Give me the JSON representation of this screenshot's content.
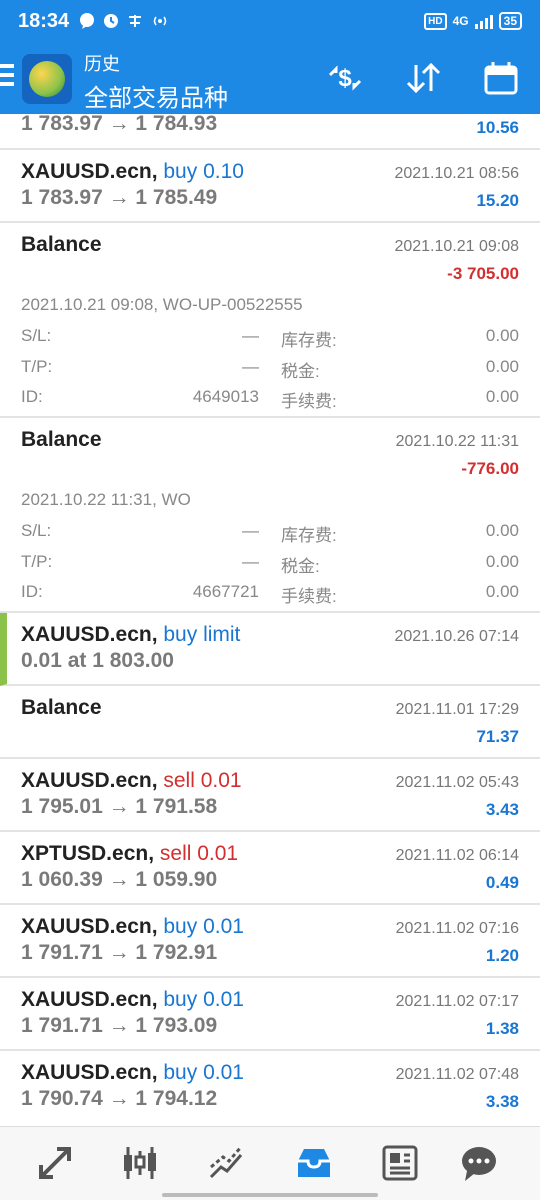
{
  "status_bar": {
    "time": "18:34",
    "net": "4G",
    "battery": "35",
    "hd": "HD"
  },
  "header": {
    "title": "历史",
    "subtitle": "全部交易品种"
  },
  "top_partial": {
    "prices": "1 783.97 → 1 784.93",
    "profit": "10.56"
  },
  "rows": [
    {
      "symbol": "XAUUSD.ecn,",
      "direction": "buy 0.10",
      "dir_color": "blue",
      "prices": "1 783.97 → 1 785.49",
      "date": "2021.10.21 08:56",
      "profit": "15.20"
    },
    {
      "symbol": "XAUUSD.ecn,",
      "direction": "buy limit",
      "dir_color": "blue",
      "prices": "0.01 at 1 803.00",
      "date": "2021.10.26 07:14",
      "profit": ""
    },
    {
      "symbol": "XAUUSD.ecn,",
      "direction": "sell 0.01",
      "dir_color": "red",
      "prices": "1 795.01 → 1 791.58",
      "date": "2021.11.02 05:43",
      "profit": "3.43"
    },
    {
      "symbol": "XPTUSD.ecn,",
      "direction": "sell 0.01",
      "dir_color": "red",
      "prices": "1 060.39 → 1 059.90",
      "date": "2021.11.02 06:14",
      "profit": "0.49"
    },
    {
      "symbol": "XAUUSD.ecn,",
      "direction": "buy 0.01",
      "dir_color": "blue",
      "prices": "1 791.71 → 1 792.91",
      "date": "2021.11.02 07:16",
      "profit": "1.20"
    },
    {
      "symbol": "XAUUSD.ecn,",
      "direction": "buy 0.01",
      "dir_color": "blue",
      "prices": "1 791.71 → 1 793.09",
      "date": "2021.11.02 07:17",
      "profit": "1.38"
    },
    {
      "symbol": "XAUUSD.ecn,",
      "direction": "buy 0.01",
      "dir_color": "blue",
      "prices": "1 790.74 → 1 794.12",
      "date": "2021.11.02 07:48",
      "profit": "3.38"
    }
  ],
  "balances": [
    {
      "title": "Balance",
      "date": "2021.10.21 09:08",
      "amount": "-3 705.00",
      "comment": "2021.10.21 09:08, WO-UP-00522555",
      "sl_label": "S/L:",
      "sl_value": "—",
      "tp_label": "T/P:",
      "tp_value": "—",
      "id_label": "ID:",
      "id_value": "4649013",
      "swap_label": "库存费:",
      "swap_value": "0.00",
      "tax_label": "税金:",
      "tax_value": "0.00",
      "fee_label": "手续费:",
      "fee_value": "0.00"
    },
    {
      "title": "Balance",
      "date": "2021.10.22 11:31",
      "amount": "-776.00",
      "comment": "2021.10.22 11:31, WO",
      "sl_label": "S/L:",
      "sl_value": "—",
      "tp_label": "T/P:",
      "tp_value": "—",
      "id_label": "ID:",
      "id_value": "4667721",
      "swap_label": "库存费:",
      "swap_value": "0.00",
      "tax_label": "税金:",
      "tax_value": "0.00",
      "fee_label": "手续费:",
      "fee_value": "0.00"
    },
    {
      "title": "Balance",
      "date": "2021.11.01 17:29",
      "amount": "71.37"
    }
  ],
  "colors": {
    "accent": "#1e88e5",
    "buy": "#1976d2",
    "sell": "#d32f2f",
    "pending": "#8bc34a"
  },
  "nav": [
    "quotes-icon",
    "chart-icon",
    "trade-icon",
    "history-icon",
    "news-icon",
    "chat-icon"
  ]
}
